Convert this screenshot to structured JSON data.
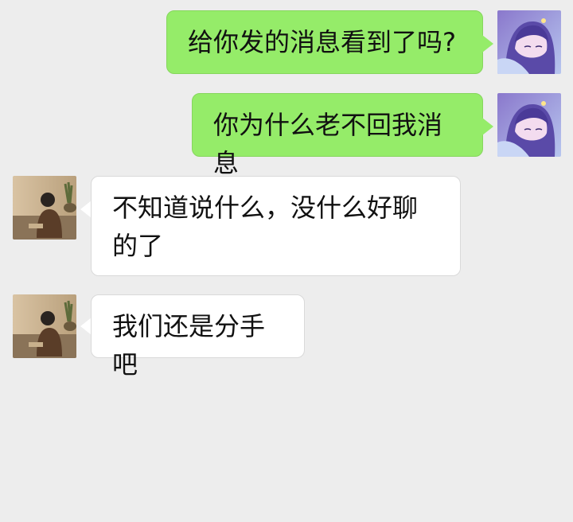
{
  "chat": {
    "messages": [
      {
        "sender": "self",
        "avatar": "anime-girl-avatar",
        "text": "给你发的消息看到了吗?"
      },
      {
        "sender": "self",
        "avatar": "anime-girl-avatar",
        "text": "你为什么老不回我消息"
      },
      {
        "sender": "contact",
        "avatar": "man-photo-avatar",
        "text": "不知道说什么，没什么好聊的了"
      },
      {
        "sender": "contact",
        "avatar": "man-photo-avatar",
        "text": "我们还是分手吧"
      }
    ]
  },
  "colors": {
    "background": "#ededed",
    "self_bubble": "#95ec69",
    "contact_bubble": "#ffffff",
    "text": "#111111"
  }
}
